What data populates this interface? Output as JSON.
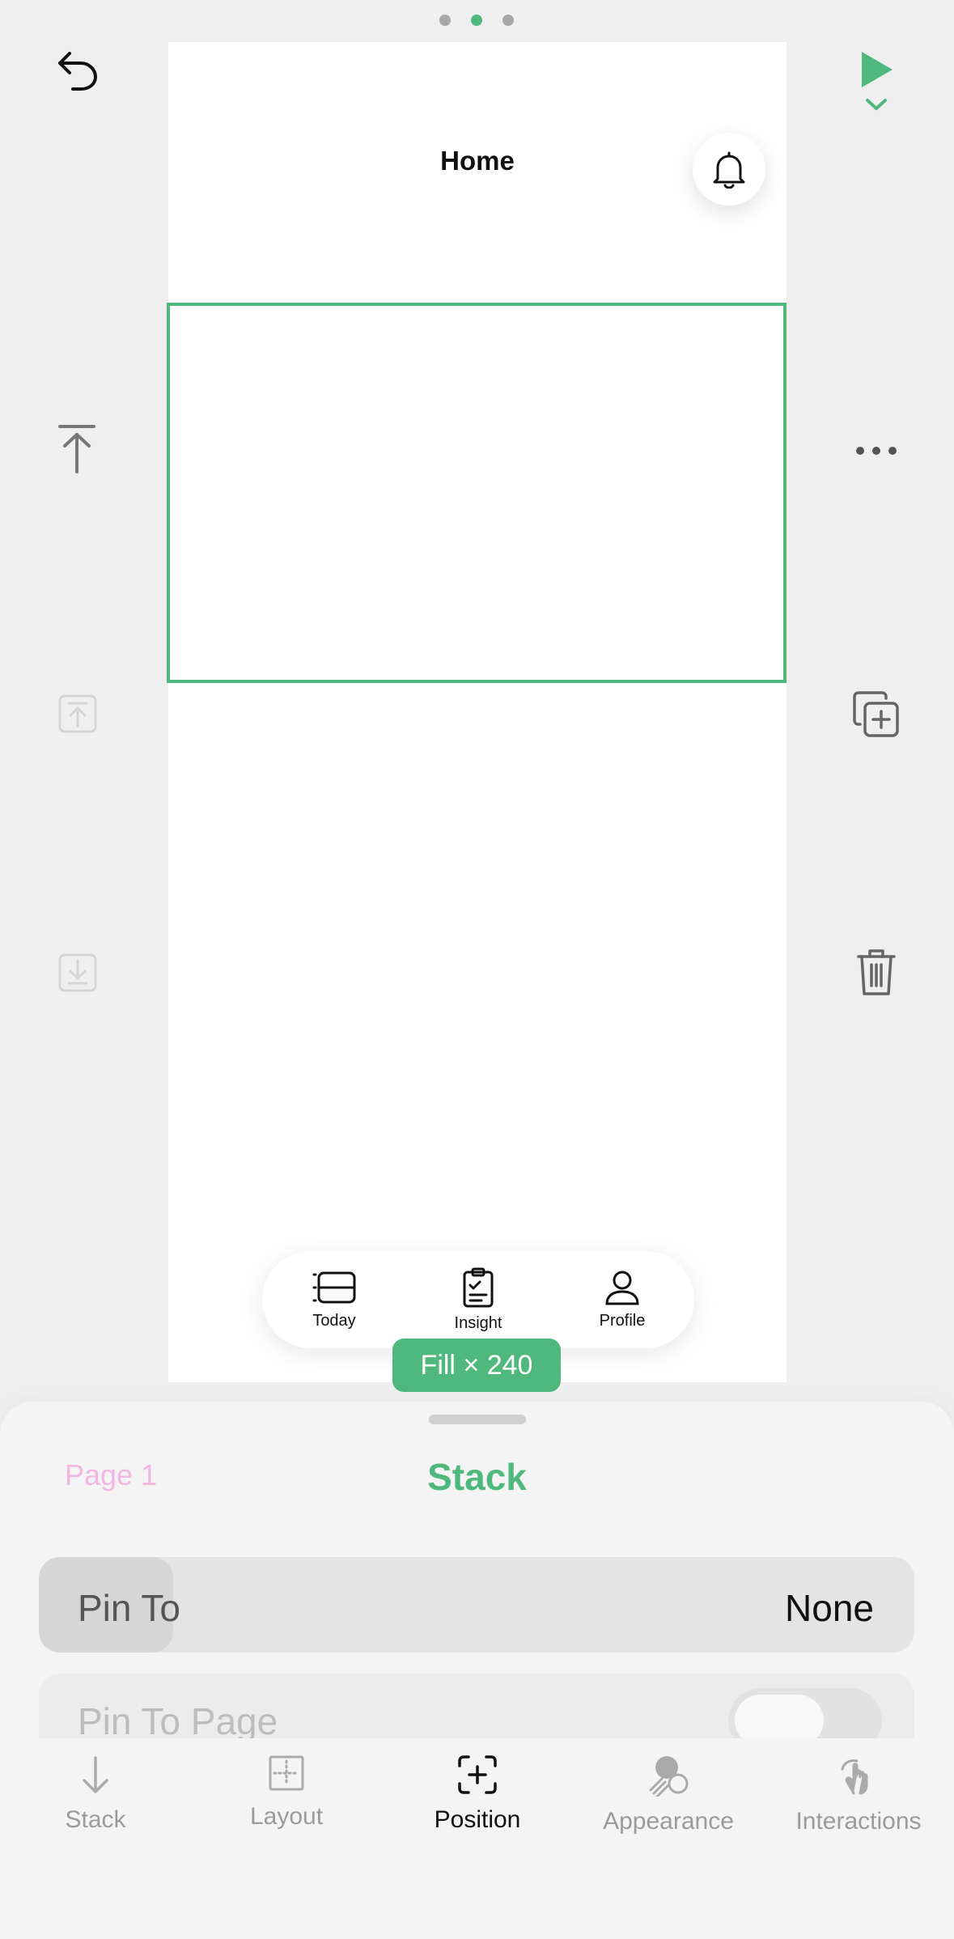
{
  "page_dots": {
    "count": 3,
    "active_index": 1
  },
  "colors": {
    "accent": "#4fb87d",
    "page_label": "#f3b6e2"
  },
  "canvas": {
    "title": "Home",
    "tabs": [
      {
        "label": "Today",
        "icon": "today-list-icon"
      },
      {
        "label": "Insight",
        "icon": "clipboard-check-icon"
      },
      {
        "label": "Profile",
        "icon": "person-icon"
      }
    ],
    "size_badge": "Fill × 240"
  },
  "sheet": {
    "page_label": "Page 1",
    "title": "Stack",
    "pin_to": {
      "label": "Pin To",
      "value": "None"
    },
    "pin_to_page": {
      "label": "Pin To Page",
      "enabled": false
    }
  },
  "bottom_nav": [
    {
      "label": "Stack",
      "icon": "arrow-down-icon",
      "active": false
    },
    {
      "label": "Layout",
      "icon": "layout-grid-icon",
      "active": false
    },
    {
      "label": "Position",
      "icon": "position-plus-icon",
      "active": true
    },
    {
      "label": "Appearance",
      "icon": "appearance-shapes-icon",
      "active": false
    },
    {
      "label": "Interactions",
      "icon": "tap-hand-icon",
      "active": false
    }
  ]
}
